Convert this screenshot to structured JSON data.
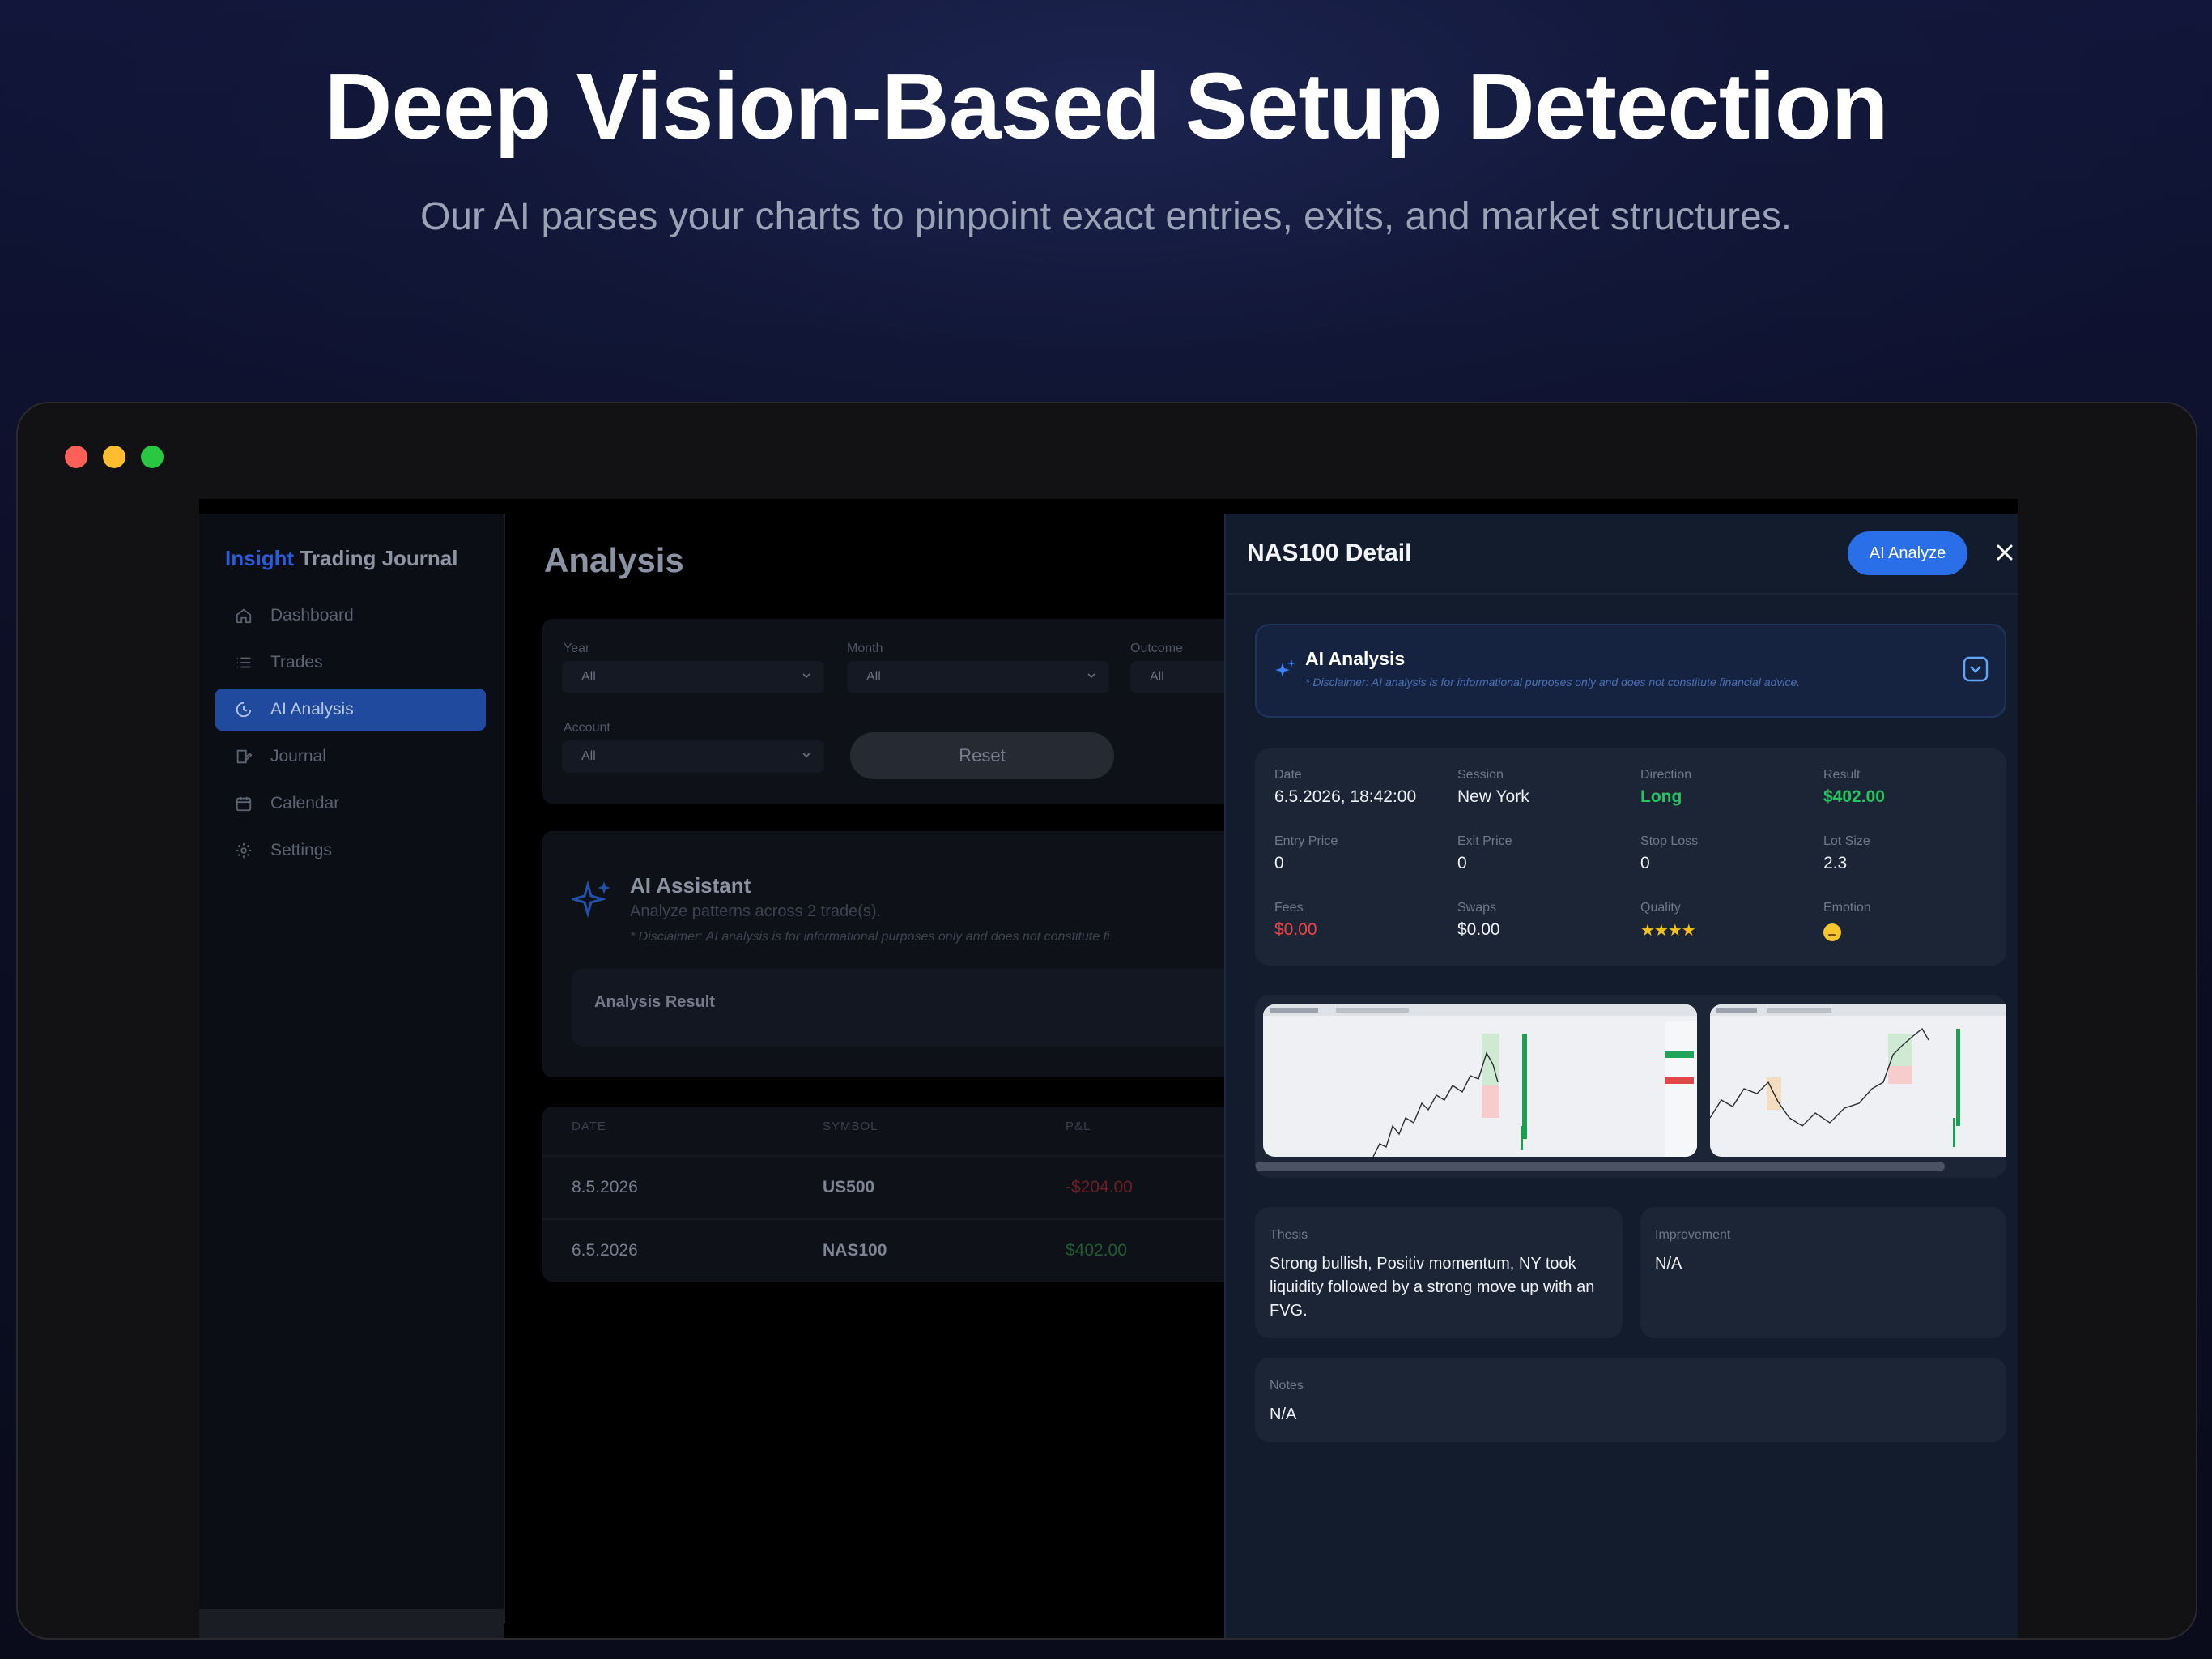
{
  "hero": {
    "title": "Deep Vision-Based Setup Detection",
    "subtitle": "Our AI parses your charts to pinpoint exact entries, exits, and market structures."
  },
  "sidebar": {
    "brand_accent": "Insight",
    "brand_rest": "Trading Journal",
    "items": [
      {
        "label": "Dashboard",
        "icon": "home-icon",
        "active": false
      },
      {
        "label": "Trades",
        "icon": "list-icon",
        "active": false
      },
      {
        "label": "AI Analysis",
        "icon": "ai-analysis-icon",
        "active": true
      },
      {
        "label": "Journal",
        "icon": "journal-icon",
        "active": false
      },
      {
        "label": "Calendar",
        "icon": "calendar-icon",
        "active": false
      },
      {
        "label": "Settings",
        "icon": "gear-icon",
        "active": false
      }
    ]
  },
  "main": {
    "title": "Analysis",
    "filters": {
      "year_label": "Year",
      "year_value": "All",
      "month_label": "Month",
      "month_value": "All",
      "outcome_label": "Outcome",
      "outcome_value": "All",
      "account_label": "Account",
      "account_value": "All",
      "reset_label": "Reset"
    },
    "assistant": {
      "title": "AI Assistant",
      "subtitle": "Analyze patterns across 2 trade(s).",
      "disclaimer": "* Disclaimer: AI analysis is for informational purposes only and does not constitute fi",
      "result_label": "Analysis Result"
    },
    "trades": {
      "headers": [
        "DATE",
        "SYMBOL",
        "P&L"
      ],
      "rows": [
        {
          "date": "8.5.2026",
          "symbol": "US500",
          "pnl": "-$204.00"
        },
        {
          "date": "6.5.2026",
          "symbol": "NAS100",
          "pnl": "$402.00"
        }
      ]
    }
  },
  "detail": {
    "title": "NAS100 Detail",
    "ai_button": "AI Analyze",
    "ai_card": {
      "title": "AI Analysis",
      "disclaimer": "* Disclaimer: AI analysis is for informational purposes only and does not constitute financial advice."
    },
    "stats": {
      "date_label": "Date",
      "date": "6.5.2026, 18:42:00",
      "session_label": "Session",
      "session": "New York",
      "direction_label": "Direction",
      "direction": "Long",
      "result_label": "Result",
      "result": "$402.00",
      "entry_label": "Entry Price",
      "entry": "0",
      "exit_label": "Exit Price",
      "exit": "0",
      "stop_label": "Stop Loss",
      "stop": "0",
      "lot_label": "Lot Size",
      "lot": "2.3",
      "fees_label": "Fees",
      "fees": "$0.00",
      "swaps_label": "Swaps",
      "swaps": "$0.00",
      "quality_label": "Quality",
      "quality": "★★★★",
      "emotion_label": "Emotion"
    },
    "thesis_label": "Thesis",
    "thesis": "Strong bullish, Positiv momentum, NY took liquidity followed by a strong move up with an FVG.",
    "improvement_label": "Improvement",
    "improvement": "N/A",
    "notes_label": "Notes",
    "notes": "N/A"
  },
  "colors": {
    "accent": "#2b6fe8",
    "positive": "#22c55e",
    "negative": "#ef4444",
    "panel": "#121c2d",
    "card": "#1c2535"
  }
}
